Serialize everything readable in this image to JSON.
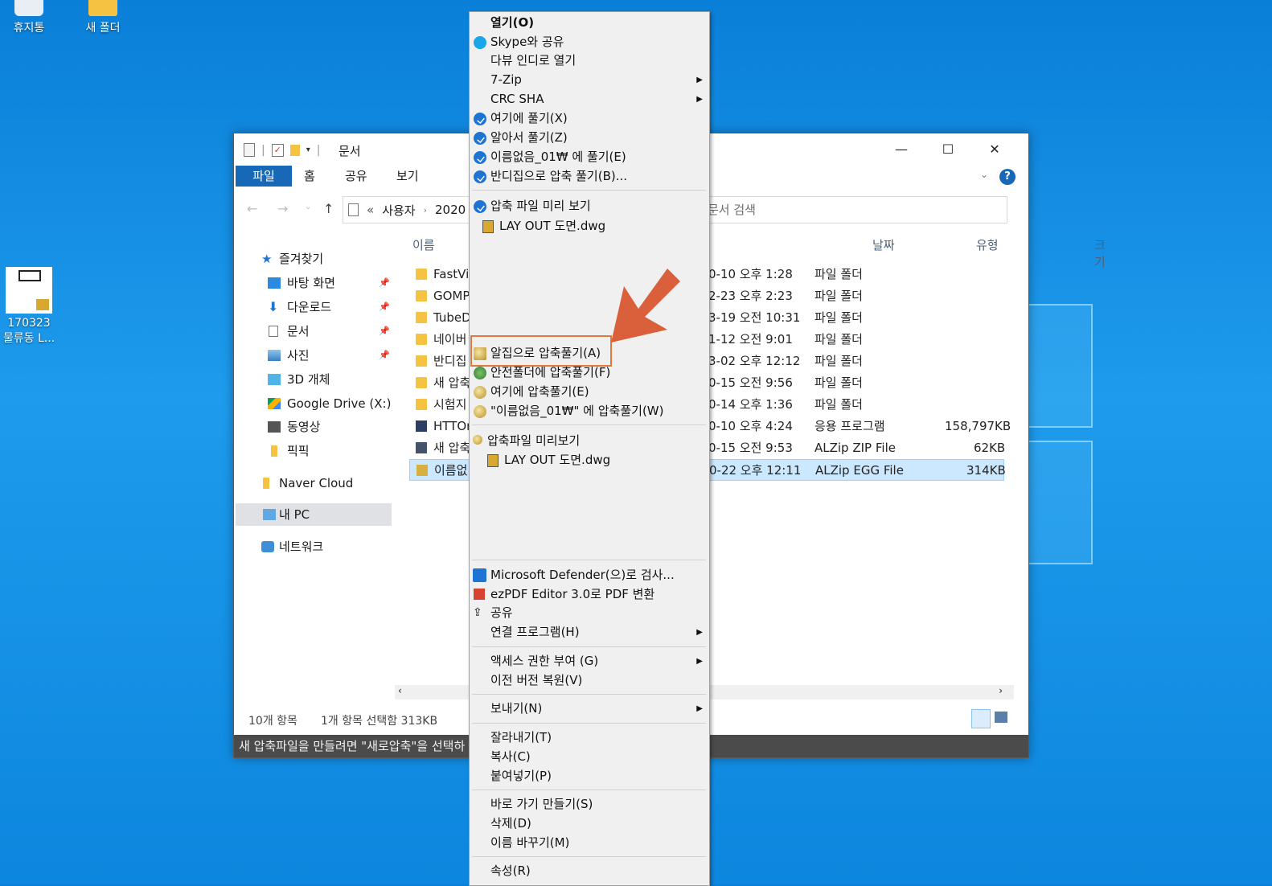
{
  "desktop": {
    "icons": [
      {
        "label": "휴지통"
      },
      {
        "label": "새 폴더"
      },
      {
        "label_line1": "170323",
        "label_line2": "물류동 L..."
      }
    ]
  },
  "explorer": {
    "title": "문서",
    "ribbon_tabs": [
      "파일",
      "홈",
      "공유",
      "보기"
    ],
    "address_path": [
      "사용자",
      "2020"
    ],
    "address_prefix": "«",
    "search_placeholder": "문서 검색",
    "nav": {
      "quick_access": "즐겨찾기",
      "items": [
        "바탕 화면",
        "다운로드",
        "문서",
        "사진",
        "3D 개체",
        "Google Drive (X:)",
        "동영상",
        "픽픽",
        "Naver Cloud",
        "내 PC",
        "네트워크"
      ]
    },
    "columns": {
      "name": "이름",
      "date": "날짜",
      "type": "유형",
      "size": "크기"
    },
    "rows": [
      {
        "name": "FastVie",
        "date": "0-10 오후 1:28",
        "type": "파일 폴더",
        "size": ""
      },
      {
        "name": "GOMP",
        "date": "2-23 오후 2:23",
        "type": "파일 폴더",
        "size": ""
      },
      {
        "name": "TubeD",
        "date": "3-19 오전 10:31",
        "type": "파일 폴더",
        "size": ""
      },
      {
        "name": "네이버",
        "date": "1-12 오전 9:01",
        "type": "파일 폴더",
        "size": ""
      },
      {
        "name": "반디집",
        "date": "3-02 오후 12:12",
        "type": "파일 폴더",
        "size": ""
      },
      {
        "name": "새 압축",
        "date": "0-15 오전 9:56",
        "type": "파일 폴더",
        "size": ""
      },
      {
        "name": "시험지",
        "date": "0-14 오후 1:36",
        "type": "파일 폴더",
        "size": ""
      },
      {
        "name": "HTTOr",
        "date": "0-10 오후 4:24",
        "type": "응용 프로그램",
        "size": "158,797KB"
      },
      {
        "name": "새 압축",
        "date": "0-15 오전 9:53",
        "type": "ALZip ZIP File",
        "size": "62KB"
      },
      {
        "name": "이름없",
        "date": "0-22 오후 12:11",
        "type": "ALZip EGG File",
        "size": "314KB"
      }
    ],
    "status": {
      "count": "10개 항목",
      "selected": "1개 항목 선택함 313KB"
    },
    "tip": "새 압축파일을 만들려면 \"새로압축\"을 선택하"
  },
  "menu": {
    "open": "열기(O)",
    "skype": "Skype와 공유",
    "multi": "다뷰 인디로 열기",
    "zip7": "7-Zip",
    "crc": "CRC SHA",
    "bandi_here": "여기에 풀기(X)",
    "bandi_smart": "알아서 풀기(Z)",
    "bandi_folder": "이름없음_01₩ 에 풀기(E)",
    "bandi_other": "반디집으로 압축 풀기(B)...",
    "bandi_preview": "압축 파일 미리 보기",
    "bandi_preview_file": "LAY OUT 도면.dwg",
    "alz_extract": "알집으로 압축풀기(A)",
    "alz_safe": "안전폴더에 압축풀기(F)",
    "alz_here": "여기에 압축풀기(E)",
    "alz_folder": "\"이름없음_01₩\" 에 압축풀기(W)",
    "alz_preview": "압축파일 미리보기",
    "alz_preview_file": "LAY OUT 도면.dwg",
    "defender": "Microsoft Defender(으)로 검사...",
    "ezpdf": "ezPDF Editor 3.0로 PDF 변환",
    "share": "공유",
    "openwith": "연결 프로그램(H)",
    "access": "액세스 권한 부여 (G)",
    "restore": "이전 버전 복원(V)",
    "sendto": "보내기(N)",
    "cut": "잘라내기(T)",
    "copy": "복사(C)",
    "paste": "붙여넣기(P)",
    "shortcut": "바로 가기 만들기(S)",
    "delete": "삭제(D)",
    "rename": "이름 바꾸기(M)",
    "properties": "속성(R)"
  },
  "colors": {
    "accent": "#1868b8",
    "highlight": "#e07a3a",
    "arrow": "#d9603a",
    "selection": "#cce8ff"
  }
}
